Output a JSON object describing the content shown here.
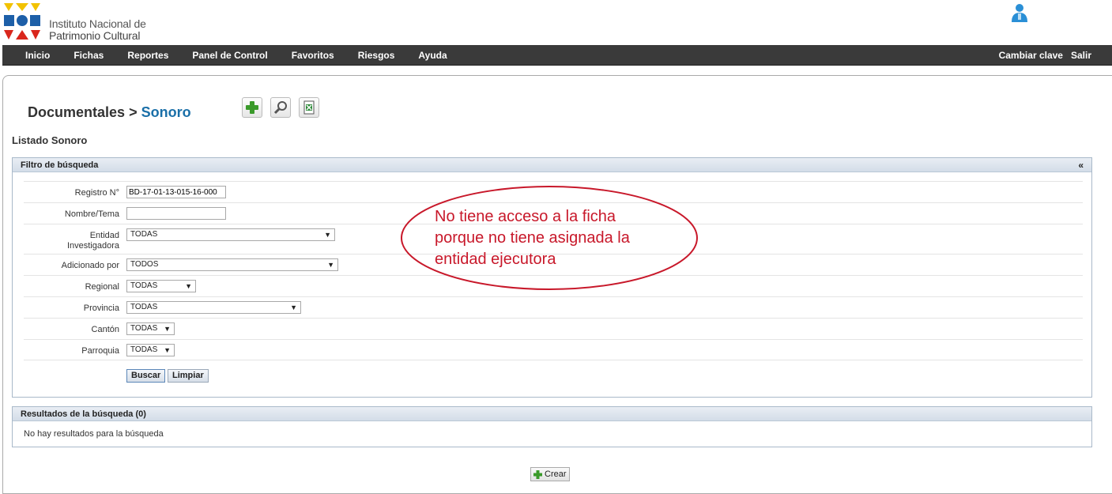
{
  "header": {
    "logo_line1": "Instituto Nacional de",
    "logo_line2": "Patrimonio Cultural",
    "logo_icon": "inpc-logo-icon",
    "user_icon": "user-icon"
  },
  "nav": {
    "items": [
      "Inicio",
      "Fichas",
      "Reportes",
      "Panel de Control",
      "Favoritos",
      "Riesgos",
      "Ayuda"
    ],
    "right": [
      "Cambiar clave",
      "Salir"
    ]
  },
  "page": {
    "crumb_parent": "Documentales",
    "crumb_sep": ">",
    "crumb_current": "Sonoro",
    "tools": [
      "add-icon",
      "search-icon",
      "excel-export-icon"
    ],
    "list_title": "Listado Sonoro"
  },
  "filter": {
    "title": "Filtro de búsqueda",
    "collapse": "«",
    "fields": {
      "registro": {
        "label": "Registro N°",
        "value": "BD-17-01-13-015-16-000"
      },
      "nombre": {
        "label": "Nombre/Tema",
        "value": ""
      },
      "entidad": {
        "label_1": "Entidad",
        "label_2": "Investigadora",
        "selected": "TODAS"
      },
      "adicionado": {
        "label": "Adicionado por",
        "selected": "TODOS"
      },
      "regional": {
        "label": "Regional",
        "selected": "TODAS"
      },
      "provincia": {
        "label": "Provincia",
        "selected": "TODAS"
      },
      "canton": {
        "label": "Cantón",
        "selected": "TODAS"
      },
      "parroquia": {
        "label": "Parroquia",
        "selected": "TODAS"
      }
    },
    "buscar": "Buscar",
    "limpiar": "Limpiar"
  },
  "results": {
    "title": "Resultados de la búsqueda (0)",
    "empty": "No hay resultados para la búsqueda"
  },
  "crear": "Crear",
  "annotation": {
    "line1": "No tiene acceso a la ficha",
    "line2": "porque no tiene asignada la",
    "line3": "entidad ejecutora"
  },
  "colors": {
    "nav_bg": "#3a3a3a",
    "crumb_current": "#1a6fa8",
    "annotation": "#c8182a"
  }
}
